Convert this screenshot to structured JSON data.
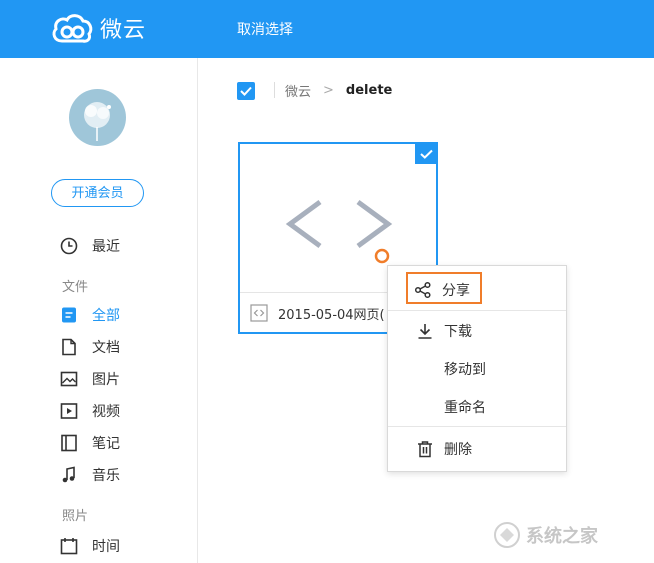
{
  "header": {
    "logo_text": "微云",
    "cancel_selection": "取消选择",
    "bg_color": "#2197f3"
  },
  "sidebar": {
    "vip_button": "开通会员",
    "recent": "最近",
    "files_section": "文件",
    "items": [
      {
        "label": "全部",
        "icon": "all-files-icon",
        "active": true
      },
      {
        "label": "文档",
        "icon": "document-icon"
      },
      {
        "label": "图片",
        "icon": "image-icon"
      },
      {
        "label": "视频",
        "icon": "video-icon"
      },
      {
        "label": "笔记",
        "icon": "note-icon"
      },
      {
        "label": "音乐",
        "icon": "music-icon"
      }
    ],
    "photos_section": "照片",
    "time": "时间"
  },
  "breadcrumb": {
    "root": "微云",
    "current": "delete"
  },
  "file": {
    "name": "2015-05-04网页(",
    "type_glyph": "< >"
  },
  "context_menu": {
    "share": "分享",
    "download": "下载",
    "move_to": "移动到",
    "rename": "重命名",
    "delete": "删除"
  },
  "watermark": {
    "text": "系统之家"
  }
}
